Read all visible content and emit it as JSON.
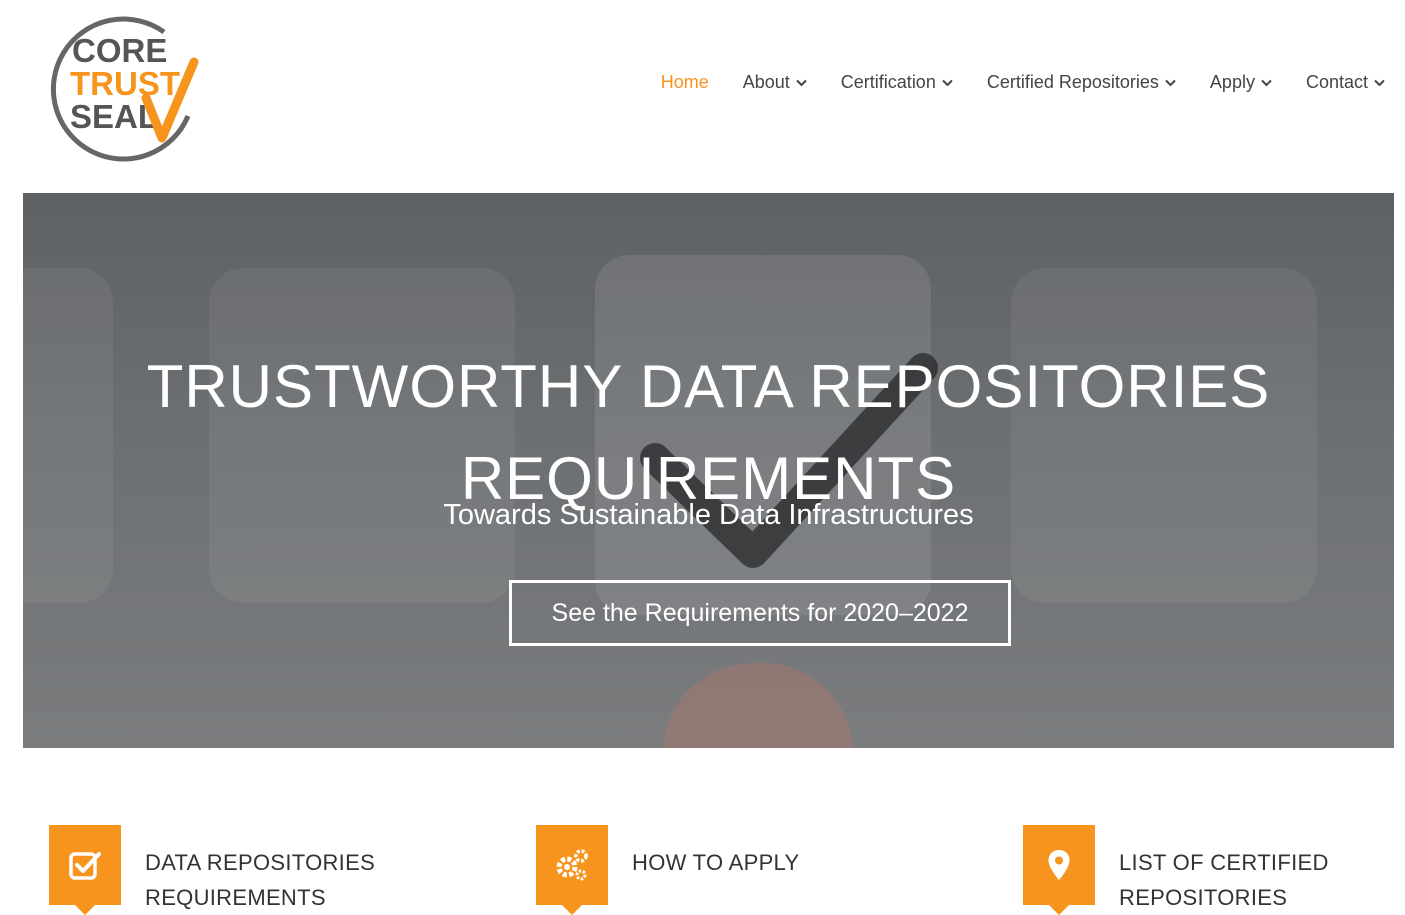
{
  "logo": {
    "lines": [
      "CORE",
      "TRUST",
      "SEAL"
    ],
    "colors": {
      "gray": "#555555",
      "orange": "#f7941d"
    }
  },
  "nav": {
    "items": [
      {
        "label": "Home",
        "active": true,
        "dropdown": false
      },
      {
        "label": "About",
        "dropdown": true
      },
      {
        "label": "Certification",
        "dropdown": true
      },
      {
        "label": "Certified Repositories",
        "dropdown": true
      },
      {
        "label": "Apply",
        "dropdown": true
      },
      {
        "label": "Contact",
        "dropdown": true
      }
    ]
  },
  "hero": {
    "title_line1": "TRUSTWORTHY DATA REPOSITORIES",
    "title_line2": "REQUIREMENTS",
    "subtitle": "Towards Sustainable Data Infrastructures",
    "button_label": "See the Requirements for 2020–2022"
  },
  "features": [
    {
      "icon": "check-square-icon",
      "line1": "DATA REPOSITORIES",
      "line2": "REQUIREMENTS"
    },
    {
      "icon": "gears-icon",
      "line1": "HOW TO APPLY",
      "line2": ""
    },
    {
      "icon": "map-marker-icon",
      "line1": "LIST OF CERTIFIED",
      "line2": "REPOSITORIES"
    }
  ],
  "accent_color": "#f7941d"
}
